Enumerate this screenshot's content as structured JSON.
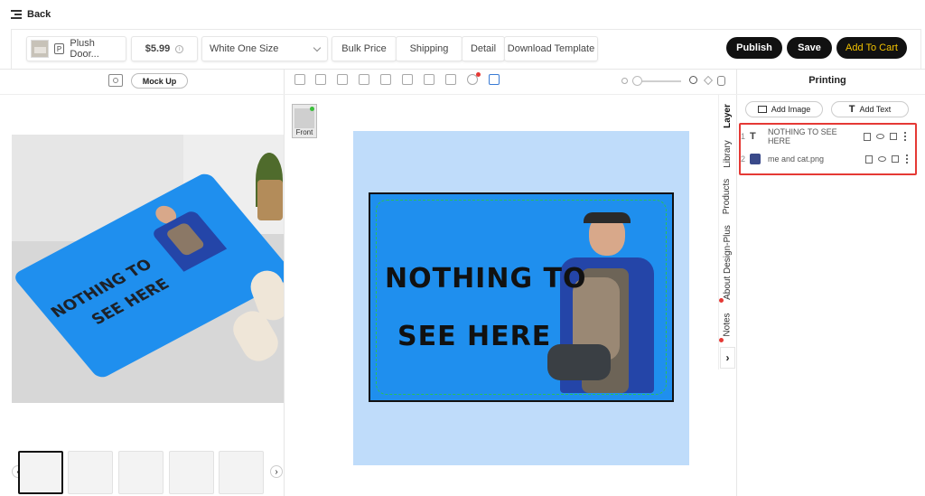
{
  "nav": {
    "back_label": "Back"
  },
  "toolbar": {
    "product_name": "Plush Door...",
    "product_badge": "P",
    "price": "$5.99",
    "variant": "White One Size",
    "bulk_price": "Bulk Price",
    "shipping": "Shipping",
    "detail": "Detail",
    "download_template": "Download Template",
    "publish": "Publish",
    "save": "Save",
    "add_to_cart": "Add To Cart"
  },
  "left_panel": {
    "mockup_label": "Mock Up"
  },
  "canvas": {
    "front_label": "Front"
  },
  "design": {
    "line1": "NOTHING TO",
    "line2": "SEE HERE"
  },
  "mockup_text": {
    "line1": "NOTHING TO",
    "line2": "SEE HERE"
  },
  "right_panel": {
    "title": "Printing",
    "add_image": "Add Image",
    "add_text": "Add Text",
    "tabs": [
      "Layer",
      "Library",
      "Products",
      "About Design-Plus",
      "Notes"
    ],
    "layers": [
      {
        "index": "1",
        "name": "NOTHING TO SEE HERE",
        "kind": "text-icon"
      },
      {
        "index": "2",
        "name": "me and cat.png",
        "kind": "image-thumb"
      }
    ]
  },
  "colors": {
    "accent_black": "#111111",
    "add_to_cart_text": "#f2c200",
    "mat_blue": "#1f8fee",
    "page_bg": "#bfdcfa",
    "highlight": "#e53935"
  }
}
